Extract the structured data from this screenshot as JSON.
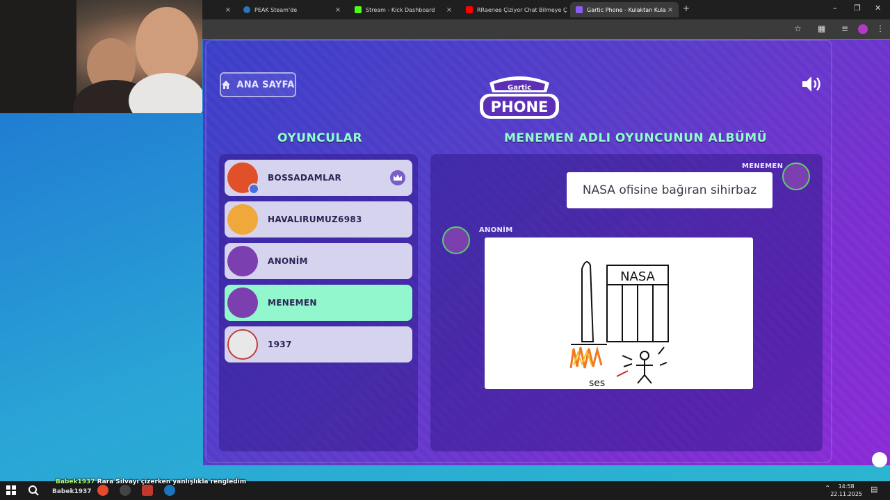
{
  "browser": {
    "tabs": [
      {
        "title": "",
        "active": false,
        "color": "#2a2a2a"
      },
      {
        "title": "PEAK Steam'de",
        "active": false,
        "color": "#2a75bb"
      },
      {
        "title": "Stream - Kick Dashboard",
        "active": false,
        "color": "#53fc18"
      },
      {
        "title": "RRaenee Çiziyor Chat Bilmeye Ç",
        "active": false,
        "color": "#ff0000"
      },
      {
        "title": "Gartic Phone - Kulaktan Kulağa",
        "active": true,
        "color": "#8b5cf6"
      }
    ],
    "new_tab_label": "+",
    "close_label": "×"
  },
  "game": {
    "home_button": "ANA SAYFA",
    "logo_top": "Gartic",
    "logo_bottom": "PHONE",
    "players_heading": "OYUNCULAR",
    "album_heading": "MENEMEN ADLI OYUNCUNUN ALBÜMÜ",
    "players": [
      {
        "name": "BOSSADAMLAR",
        "selected": false,
        "host": true,
        "avatar_color": "#e2502a"
      },
      {
        "name": "HAVALIRUMUZ6983",
        "selected": false,
        "host": false,
        "avatar_color": "#f0a83a"
      },
      {
        "name": "ANONİM",
        "selected": false,
        "host": false,
        "avatar_color": "#7b3fb0"
      },
      {
        "name": "MENEMEN",
        "selected": true,
        "host": false,
        "avatar_color": "#7b3fb0"
      },
      {
        "name": "1937",
        "selected": false,
        "host": false,
        "avatar_color": "#d8d8d8"
      }
    ],
    "album": {
      "first_author": "MENEMEN",
      "prompt_text": "NASA ofisine bağıran sihirbaz",
      "second_author": "ANONİM",
      "drawing_label": "NASA",
      "drawing_caption": "ses"
    }
  },
  "chat": {
    "user": "Babek1937",
    "message": "Rara Silvayı çizerken yanlışlıkla rengledim",
    "user_echo": "Babek1937"
  },
  "taskbar": {
    "time": "14:58",
    "date": "22.11.2025"
  },
  "colors": {
    "accent_green": "#8effc8",
    "selected_row": "#93f7cd",
    "panel": "#341c8c"
  }
}
